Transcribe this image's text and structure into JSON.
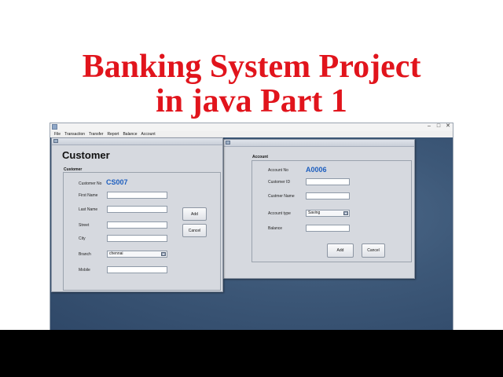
{
  "banner": {
    "line1": "Banking System Project",
    "line2": "in java Part 1"
  },
  "menu": [
    "File",
    "Transaction",
    "Transfer",
    "Report",
    "Balance",
    "Account"
  ],
  "customer_frame": {
    "heading": "Customer",
    "panel_title": "Customer",
    "customer_no_label": "Customer No",
    "customer_no_value": "CS007",
    "first_name_label": "First Name",
    "last_name_label": "Last Name",
    "street_label": "Street",
    "city_label": "City",
    "branch_label": "Branch",
    "branch_value": "chennai",
    "mobile_label": "Mobile",
    "add_label": "Add",
    "cancel_label": "Cancel"
  },
  "account_frame": {
    "panel_title": "Account",
    "account_no_label": "Account No",
    "account_no_value": "A0006",
    "customer_id_label": "Customer ID",
    "customer_name_label": "Custmer Name",
    "account_type_label": "Account type",
    "account_type_value": "Saving",
    "balance_label": "Balance",
    "add_label": "Add",
    "cancel_label": "Cancel"
  },
  "window_controls": {
    "minimize": "–",
    "maximize": "□",
    "close": "✕"
  },
  "colors": {
    "banner_red": "#e1141c",
    "value_blue": "#1e5fbf",
    "desktop_blue": "#3d5878"
  }
}
